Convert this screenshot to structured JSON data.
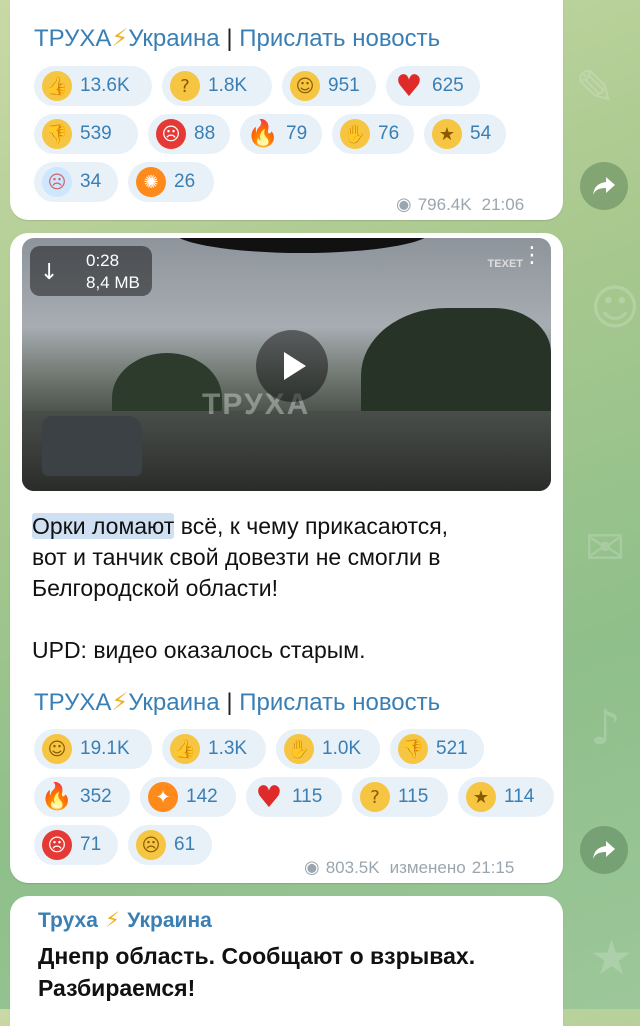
{
  "message1": {
    "signature": {
      "channel": "ТРУХА",
      "country": "Украина",
      "separator": "|",
      "link": "Прислать новость"
    },
    "reactions": [
      {
        "emoji": "thumbs-up",
        "count": "13.6K"
      },
      {
        "emoji": "thinking-face",
        "count": "1.8K"
      },
      {
        "emoji": "grinning-face",
        "count": "951"
      },
      {
        "emoji": "red-heart",
        "count": "625"
      },
      {
        "emoji": "thumbs-down",
        "count": "539"
      },
      {
        "emoji": "cursing-face",
        "count": "88"
      },
      {
        "emoji": "fire",
        "count": "79"
      },
      {
        "emoji": "clapping-hands",
        "count": "76"
      },
      {
        "emoji": "star-struck",
        "count": "54"
      },
      {
        "emoji": "screaming-face",
        "count": "34"
      },
      {
        "emoji": "exploding-head",
        "count": "26"
      }
    ],
    "views": "796.4K",
    "time": "21:06"
  },
  "message2": {
    "video": {
      "duration": "0:28",
      "size": "8,4 MB",
      "watermark": "ТРУХА",
      "corner_mark": "TEXET"
    },
    "text": {
      "highlight": "Орки ломают",
      "line1_rest": " всё, к чему прикасаются,",
      "line2": "вот и танчик свой довезти не смогли в",
      "line3": "Белгородской области!",
      "line4": "UPD: видео оказалось старым."
    },
    "signature": {
      "channel": "ТРУХА",
      "country": "Украина",
      "separator": "|",
      "link": "Прислать новость"
    },
    "reactions": [
      {
        "emoji": "grinning-face",
        "count": "19.1K"
      },
      {
        "emoji": "thumbs-up",
        "count": "1.3K"
      },
      {
        "emoji": "clapping-hands",
        "count": "1.0K"
      },
      {
        "emoji": "thumbs-down",
        "count": "521"
      },
      {
        "emoji": "fire",
        "count": "352"
      },
      {
        "emoji": "party-popper",
        "count": "142"
      },
      {
        "emoji": "red-heart",
        "count": "115"
      },
      {
        "emoji": "thinking-face",
        "count": "115"
      },
      {
        "emoji": "star-struck",
        "count": "114"
      },
      {
        "emoji": "cursing-face",
        "count": "71"
      },
      {
        "emoji": "crying-face",
        "count": "61"
      }
    ],
    "views": "803.5K",
    "edited": "изменено",
    "time": "21:15"
  },
  "message3": {
    "channel": "Труха",
    "country": "Украина",
    "text_line1": "Днепр область. Сообщают о взрывах.",
    "text_line2": "Разбираемся!"
  },
  "colors": {
    "link": "#3a7fb4",
    "chip_bg": "#e8f0f8",
    "meta": "#9aa6af",
    "highlight": "#cfe0f3"
  }
}
